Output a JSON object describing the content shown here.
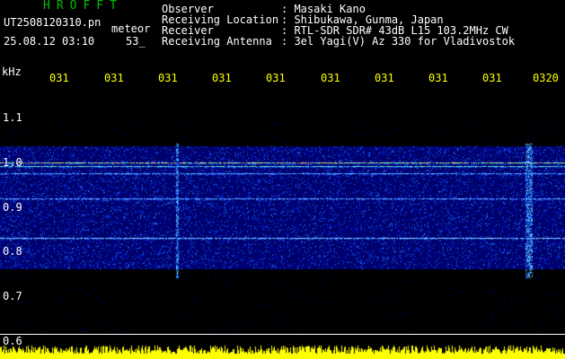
{
  "header": {
    "brand": "HROFFT",
    "file_name": "UT2508120310.pn",
    "tag": "meteor",
    "date_time": "25.08.12 03:10",
    "count": "53_"
  },
  "meta": [
    {
      "label": "Observer",
      "value": ": Masaki Kano"
    },
    {
      "label": "Receiving Location",
      "value": ": Shibukawa, Gunma, Japan"
    },
    {
      "label": "Receiver",
      "value": ": RTL-SDR SDR# 43dB L15 103.2MHz CW"
    },
    {
      "label": "Receiving Antenna",
      "value": ": 3el Yagi(V) Az 330 for Vladivostok"
    }
  ],
  "time_axis": {
    "labels": [
      "031",
      "031",
      "031",
      "031",
      "031",
      "031",
      "031",
      "031",
      "031",
      "0320"
    ]
  },
  "freq_axis": {
    "unit": "kHz",
    "labels": [
      "1.1",
      "1.0",
      "0.9",
      "0.8",
      "0.7",
      "0.6"
    ]
  },
  "colors": {
    "text_green": "#00c000",
    "text_white": "#ffffff",
    "tick_yellow": "#ffff00",
    "waterfall_bg": "#000080"
  }
}
